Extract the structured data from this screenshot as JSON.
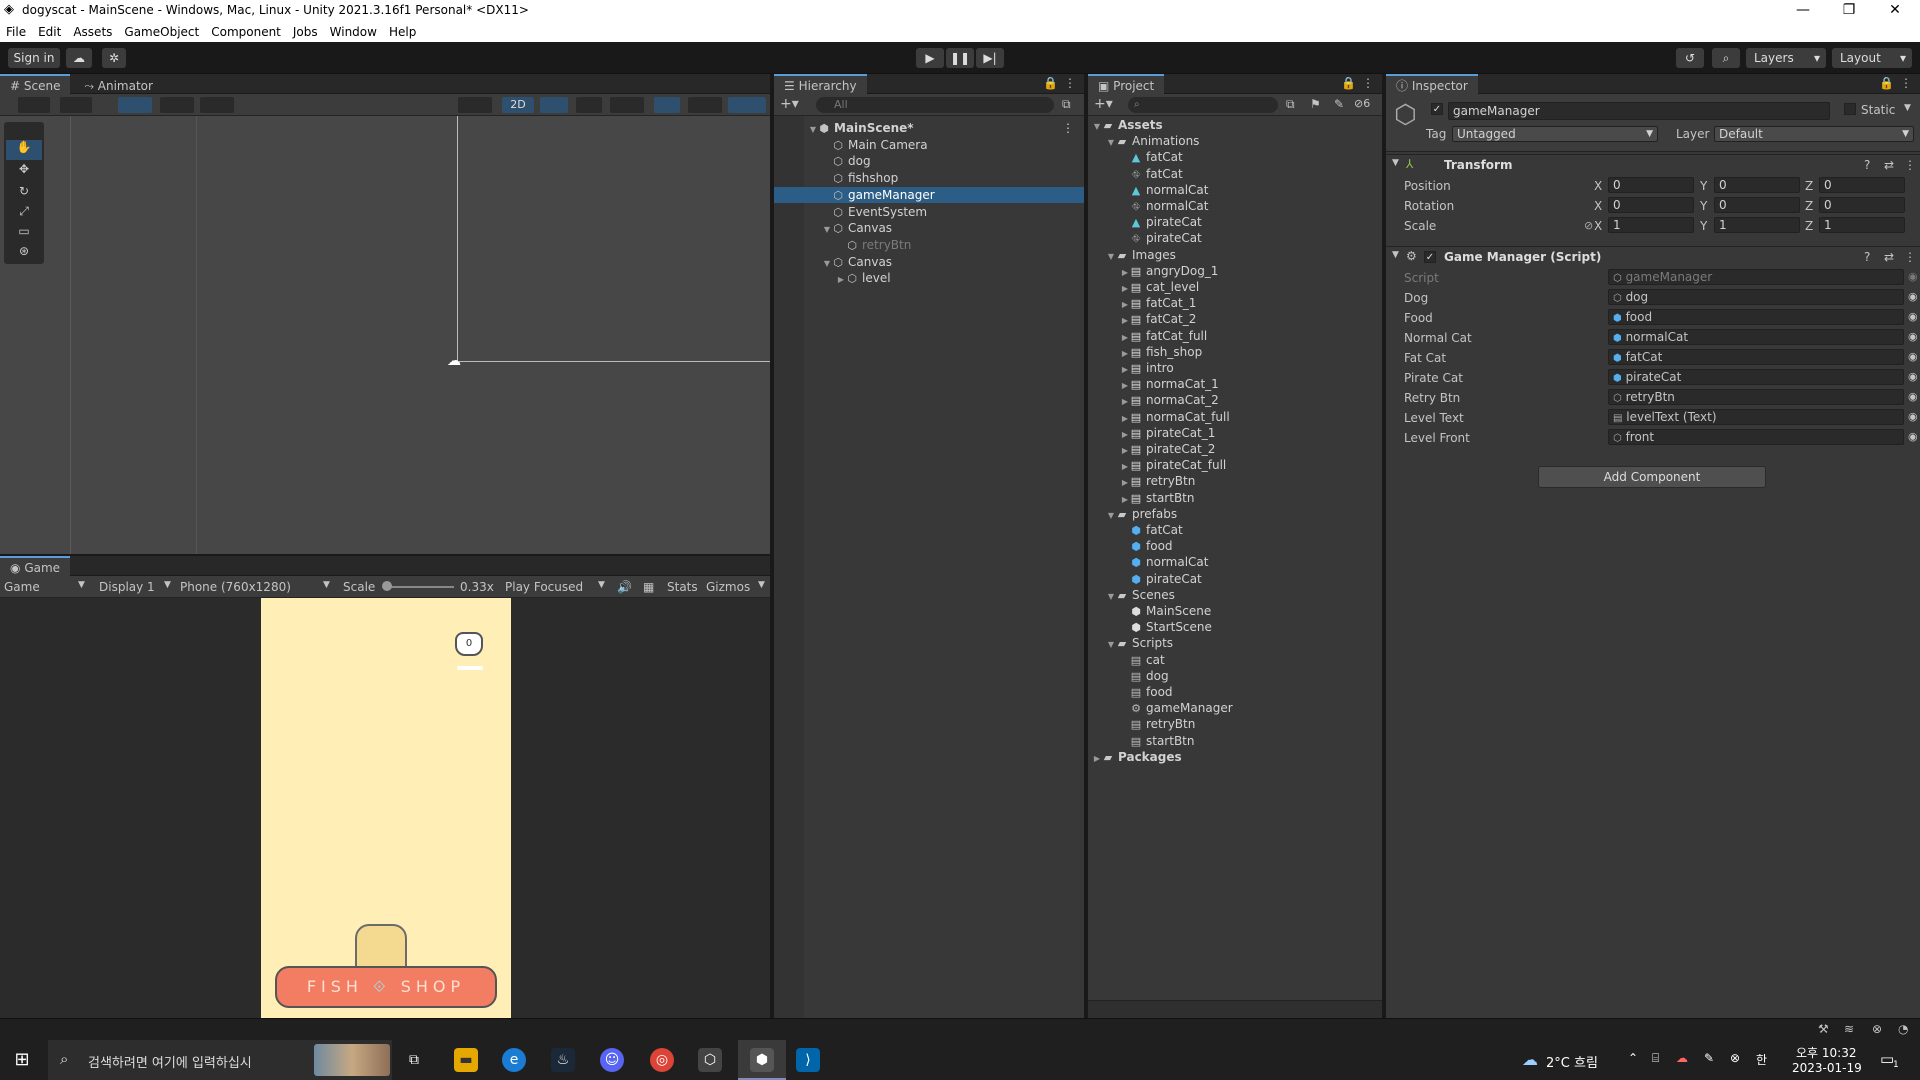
{
  "window": {
    "title": "dogyscat - MainScene - Windows, Mac, Linux - Unity 2021.3.16f1 Personal* <DX11>",
    "minimize": "—",
    "restore": "❐",
    "close": "✕"
  },
  "menu": [
    "File",
    "Edit",
    "Assets",
    "GameObject",
    "Component",
    "Jobs",
    "Window",
    "Help"
  ],
  "toolbar": {
    "sign_in": "Sign in",
    "layers": "Layers",
    "layout": "Layout"
  },
  "scene": {
    "tab_scene": "Scene",
    "tab_animator": "Animator",
    "mode_2d": "2D"
  },
  "game": {
    "tab": "Game",
    "view": "Game",
    "display": "Display 1",
    "resolution": "Phone (760x1280)",
    "scale_label": "Scale",
    "scale_value": "0.33x",
    "play_mode": "Play Focused",
    "stats": "Stats",
    "gizmos": "Gizmos",
    "counter": "0",
    "shop_left": "FISH",
    "shop_right": "SHOP"
  },
  "hierarchy": {
    "tab": "Hierarchy",
    "search_placeholder": "All",
    "items": [
      {
        "label": "MainScene*",
        "depth": 0,
        "icon": "unity-scene-icon",
        "expanded": true
      },
      {
        "label": "Main Camera",
        "depth": 1,
        "icon": "gameobject-icon"
      },
      {
        "label": "dog",
        "depth": 1,
        "icon": "gameobject-icon"
      },
      {
        "label": "fishshop",
        "depth": 1,
        "icon": "gameobject-icon"
      },
      {
        "label": "gameManager",
        "depth": 1,
        "icon": "gameobject-icon",
        "selected": true
      },
      {
        "label": "EventSystem",
        "depth": 1,
        "icon": "gameobject-icon"
      },
      {
        "label": "Canvas",
        "depth": 1,
        "icon": "gameobject-icon",
        "expanded": true
      },
      {
        "label": "retryBtn",
        "depth": 2,
        "icon": "gameobject-icon",
        "dim": true
      },
      {
        "label": "Canvas",
        "depth": 1,
        "icon": "gameobject-icon",
        "expanded": true
      },
      {
        "label": "level",
        "depth": 2,
        "icon": "gameobject-icon",
        "collapsed": true
      }
    ]
  },
  "project": {
    "tab": "Project",
    "hidden_count": "6",
    "items": [
      {
        "label": "Assets",
        "depth": 0,
        "type": "folder",
        "expanded": true,
        "bold": true
      },
      {
        "label": "Animations",
        "depth": 1,
        "type": "folder",
        "expanded": true
      },
      {
        "label": "fatCat",
        "depth": 2,
        "type": "anim"
      },
      {
        "label": "fatCat",
        "depth": 2,
        "type": "controller"
      },
      {
        "label": "normalCat",
        "depth": 2,
        "type": "anim"
      },
      {
        "label": "normalCat",
        "depth": 2,
        "type": "controller"
      },
      {
        "label": "pirateCat",
        "depth": 2,
        "type": "anim"
      },
      {
        "label": "pirateCat",
        "depth": 2,
        "type": "controller"
      },
      {
        "label": "Images",
        "depth": 1,
        "type": "folder",
        "expanded": true
      },
      {
        "label": "angryDog_1",
        "depth": 2,
        "type": "image",
        "collapsed": true
      },
      {
        "label": "cat_level",
        "depth": 2,
        "type": "image",
        "collapsed": true
      },
      {
        "label": "fatCat_1",
        "depth": 2,
        "type": "image",
        "collapsed": true
      },
      {
        "label": "fatCat_2",
        "depth": 2,
        "type": "image",
        "collapsed": true
      },
      {
        "label": "fatCat_full",
        "depth": 2,
        "type": "image",
        "collapsed": true
      },
      {
        "label": "fish_shop",
        "depth": 2,
        "type": "image",
        "collapsed": true
      },
      {
        "label": "intro",
        "depth": 2,
        "type": "image",
        "collapsed": true
      },
      {
        "label": "normaCat_1",
        "depth": 2,
        "type": "image",
        "collapsed": true
      },
      {
        "label": "normaCat_2",
        "depth": 2,
        "type": "image",
        "collapsed": true
      },
      {
        "label": "normaCat_full",
        "depth": 2,
        "type": "image",
        "collapsed": true
      },
      {
        "label": "pirateCat_1",
        "depth": 2,
        "type": "image",
        "collapsed": true
      },
      {
        "label": "pirateCat_2",
        "depth": 2,
        "type": "image",
        "collapsed": true
      },
      {
        "label": "pirateCat_full",
        "depth": 2,
        "type": "image",
        "collapsed": true
      },
      {
        "label": "retryBtn",
        "depth": 2,
        "type": "image",
        "collapsed": true
      },
      {
        "label": "startBtn",
        "depth": 2,
        "type": "image",
        "collapsed": true
      },
      {
        "label": "prefabs",
        "depth": 1,
        "type": "folder",
        "expanded": true
      },
      {
        "label": "fatCat",
        "depth": 2,
        "type": "prefab"
      },
      {
        "label": "food",
        "depth": 2,
        "type": "prefab"
      },
      {
        "label": "normalCat",
        "depth": 2,
        "type": "prefab"
      },
      {
        "label": "pirateCat",
        "depth": 2,
        "type": "prefab"
      },
      {
        "label": "Scenes",
        "depth": 1,
        "type": "folder",
        "expanded": true
      },
      {
        "label": "MainScene",
        "depth": 2,
        "type": "scene"
      },
      {
        "label": "StartScene",
        "depth": 2,
        "type": "scene"
      },
      {
        "label": "Scripts",
        "depth": 1,
        "type": "folder",
        "expanded": true
      },
      {
        "label": "cat",
        "depth": 2,
        "type": "script"
      },
      {
        "label": "dog",
        "depth": 2,
        "type": "script"
      },
      {
        "label": "food",
        "depth": 2,
        "type": "script"
      },
      {
        "label": "gameManager",
        "depth": 2,
        "type": "gear-script"
      },
      {
        "label": "retryBtn",
        "depth": 2,
        "type": "script"
      },
      {
        "label": "startBtn",
        "depth": 2,
        "type": "script"
      },
      {
        "label": "Packages",
        "depth": 0,
        "type": "folder",
        "collapsed": true,
        "bold": true
      }
    ]
  },
  "inspector": {
    "tab": "Inspector",
    "object_name": "gameManager",
    "static_label": "Static",
    "tag_label": "Tag",
    "tag_value": "Untagged",
    "layer_label": "Layer",
    "layer_value": "Default",
    "transform": {
      "title": "Transform",
      "rows": [
        {
          "label": "Position",
          "x": "0",
          "y": "0",
          "z": "0"
        },
        {
          "label": "Rotation",
          "x": "0",
          "y": "0",
          "z": "0"
        },
        {
          "label": "Scale",
          "x": "1",
          "y": "1",
          "z": "1"
        }
      ],
      "axis_x": "X",
      "axis_y": "Y",
      "axis_z": "Z"
    },
    "script_component": {
      "title": "Game Manager (Script)",
      "fields": [
        {
          "label": "Script",
          "value": "gameManager",
          "dim": true
        },
        {
          "label": "Dog",
          "value": "dog"
        },
        {
          "label": "Food",
          "value": "food"
        },
        {
          "label": "Normal Cat",
          "value": "normalCat"
        },
        {
          "label": "Fat Cat",
          "value": "fatCat"
        },
        {
          "label": "Pirate Cat",
          "value": "pirateCat"
        },
        {
          "label": "Retry Btn",
          "value": "retryBtn"
        },
        {
          "label": "Level Text",
          "value": "levelText (Text)"
        },
        {
          "label": "Level Front",
          "value": "front"
        }
      ]
    },
    "add_component": "Add Component"
  },
  "taskbar": {
    "search_placeholder": "검색하려면 여기에 입력하십시",
    "weather": "2°C 흐림",
    "time": "오후 10:32",
    "date": "2023-01-19",
    "notifications": "1"
  },
  "colors": {
    "selection": "#2c5d87",
    "accent": "#5c9dd9",
    "game_bg": "#ffefb6",
    "shop_color": "#f27d62"
  }
}
